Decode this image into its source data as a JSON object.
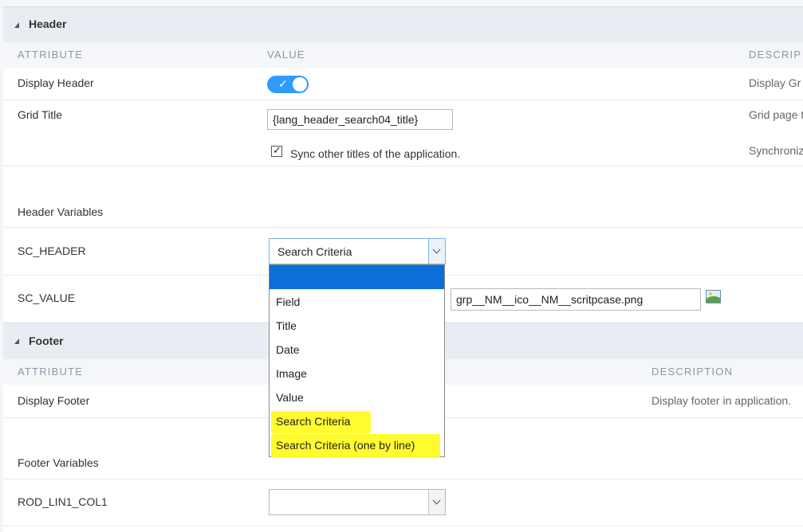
{
  "header_section": {
    "title": "Header",
    "col_attribute": "ATTRIBUTE",
    "col_value": "VALUE",
    "col_description": "DESCRIP",
    "display_header": {
      "label": "Display Header",
      "enabled": true,
      "desc": "Display Gr"
    },
    "grid_title": {
      "label": "Grid Title",
      "value": "{lang_header_search04_title}",
      "desc": "Grid page t"
    },
    "sync": {
      "label": "Sync other titles of the application.",
      "checked": true,
      "desc": "Synchroniz"
    },
    "variables_label": "Header Variables",
    "sc_header": {
      "label": "SC_HEADER",
      "selected": "Search Criteria"
    },
    "sc_value": {
      "label": "SC_VALUE",
      "value": "grp__NM__ico__NM__scritpcase.png"
    }
  },
  "dropdown": {
    "options": [
      "",
      "Field",
      "Title",
      "Date",
      "Image",
      "Value",
      "Search Criteria",
      "Search Criteria (one by line)"
    ],
    "highlighted_color": "#fffb24",
    "selected_bg": "#0a6fd6"
  },
  "footer_section": {
    "title": "Footer",
    "col_attribute": "ATTRIBUTE",
    "col_description": "DESCRIPTION",
    "display_footer": {
      "label": "Display Footer",
      "desc": "Display footer in application."
    },
    "variables_label": "Footer Variables",
    "rod_lin1_col1": {
      "label": "ROD_LIN1_COL1",
      "selected": ""
    }
  },
  "colors": {
    "toggle_on": "#2f9bff",
    "section_bg": "#e8edf3",
    "column_header": "#8b97a6"
  }
}
